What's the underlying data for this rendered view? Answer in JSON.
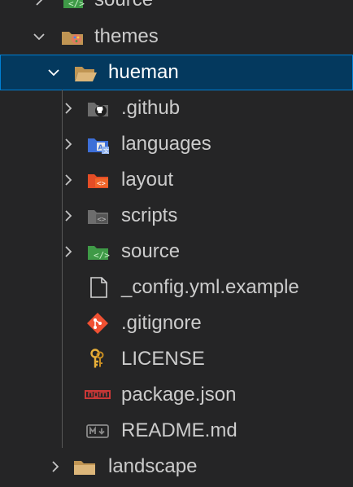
{
  "explorer": {
    "rows": [
      {
        "label": "source",
        "kind": "folder-source",
        "expanded": false
      },
      {
        "label": "themes",
        "kind": "folder-themes",
        "expanded": true
      },
      {
        "label": "hueman",
        "kind": "folder-open",
        "expanded": true,
        "selected": true
      },
      {
        "label": ".github",
        "kind": "folder-github",
        "expanded": false
      },
      {
        "label": "languages",
        "kind": "folder-languages",
        "expanded": false
      },
      {
        "label": "layout",
        "kind": "folder-layout",
        "expanded": false
      },
      {
        "label": "scripts",
        "kind": "folder-scripts",
        "expanded": false
      },
      {
        "label": "source",
        "kind": "folder-source",
        "expanded": false
      },
      {
        "label": "_config.yml.example",
        "kind": "file-generic"
      },
      {
        "label": ".gitignore",
        "kind": "file-git"
      },
      {
        "label": "LICENSE",
        "kind": "file-license"
      },
      {
        "label": "package.json",
        "kind": "file-npm"
      },
      {
        "label": "README.md",
        "kind": "file-markdown"
      },
      {
        "label": "landscape",
        "kind": "folder-closed",
        "expanded": false
      }
    ]
  },
  "colors": {
    "background": "#252526",
    "selection": "#04395e",
    "selection_border": "#007fd4",
    "text": "#cccccc",
    "folder": "#c09553",
    "source_green": "#3f9a47",
    "layout_orange": "#e44d26",
    "git_red": "#f05133",
    "npm_red": "#cb3837"
  }
}
